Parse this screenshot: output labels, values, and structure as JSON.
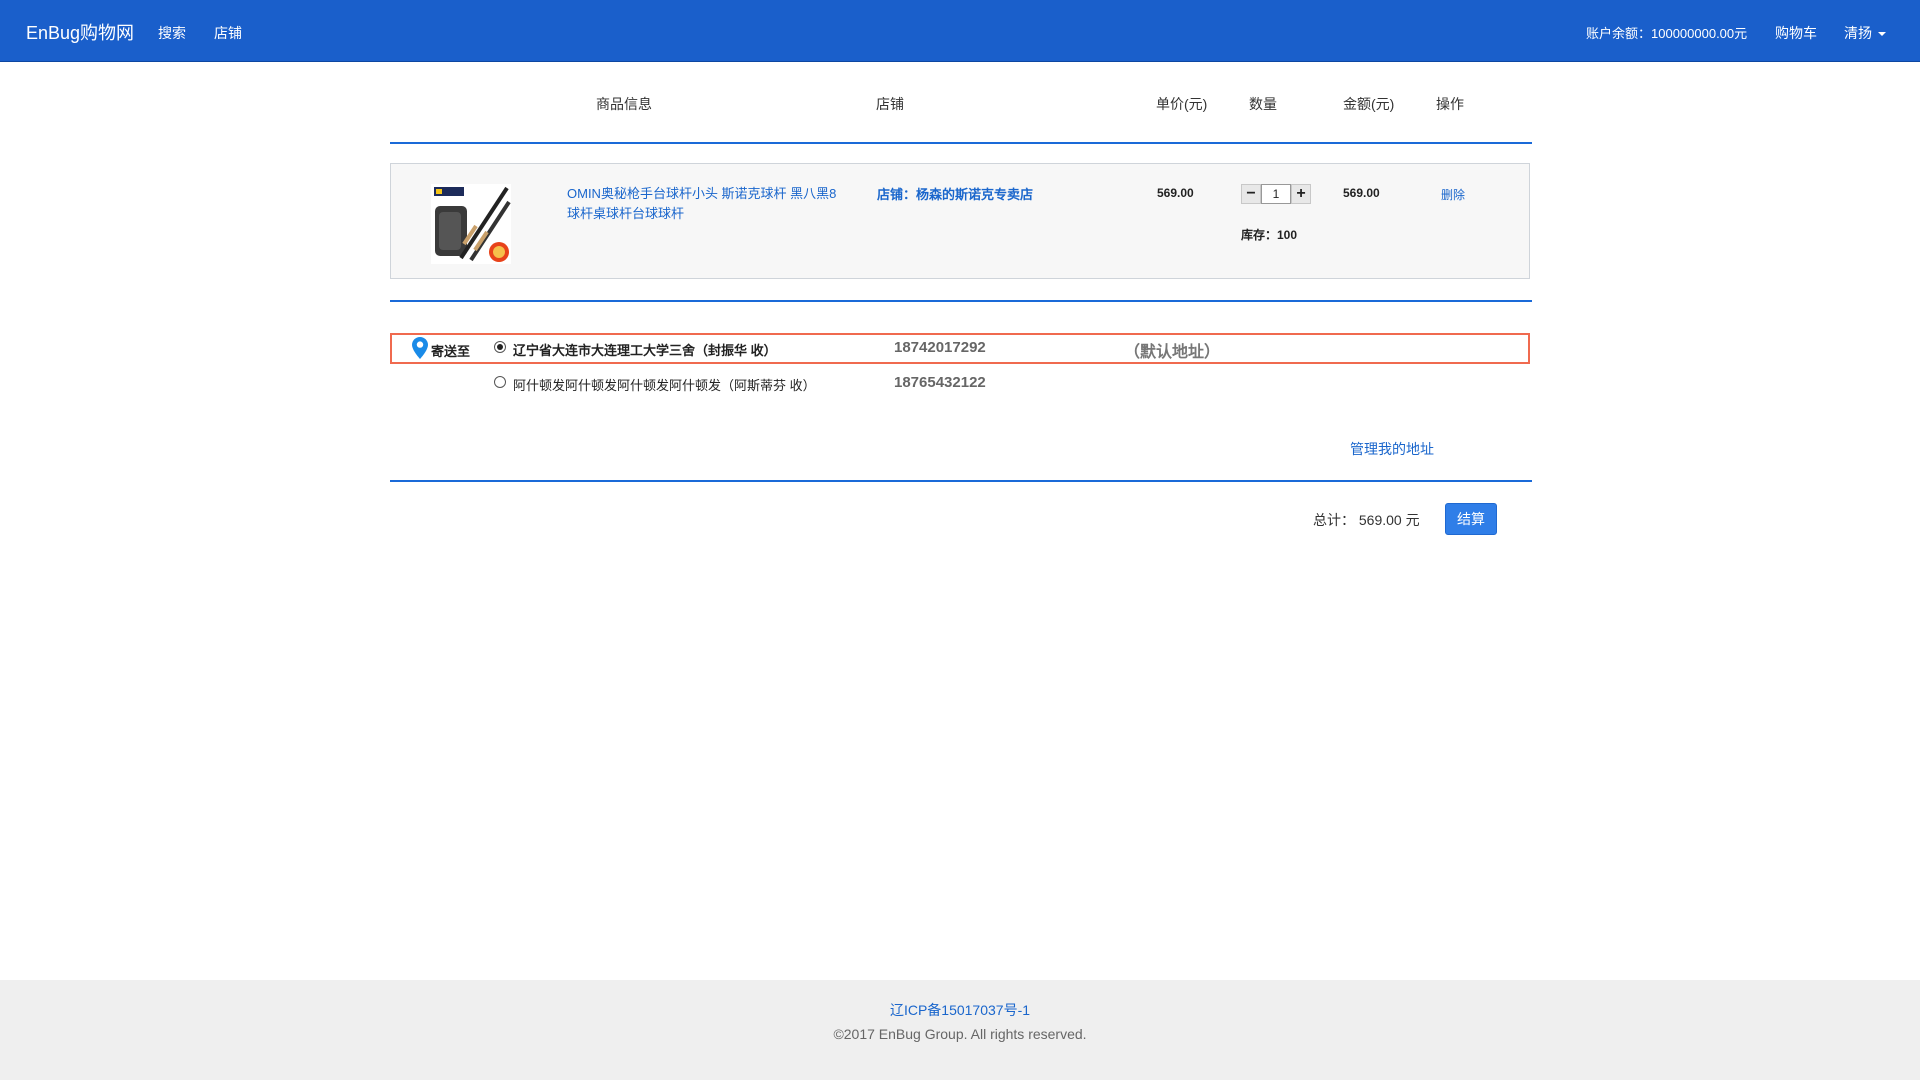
{
  "navbar": {
    "brand": "EnBug购物网",
    "search": "搜索",
    "shops": "店铺",
    "balance": "账户余额：100000000.00元",
    "cart": "购物车",
    "user": "清扬"
  },
  "table_header": {
    "product_info": "商品信息",
    "shop": "店铺",
    "unit_price": "单价(元)",
    "quantity": "数量",
    "amount": "金额(元)",
    "action": "操作"
  },
  "cart_items": [
    {
      "name": "OMIN奥秘枪手台球杆小头 斯诺克球杆 黑八黑8球杆桌球杆台球球杆",
      "shop": "店铺：杨森的斯诺克专卖店",
      "price": "569.00",
      "quantity": "1",
      "stock": "库存：100",
      "amount": "569.00",
      "delete": "删除"
    }
  ],
  "shipping": {
    "label": "寄送至",
    "addresses": [
      {
        "text": "辽宁省大连市大连理工大学三舍（封振华 收）",
        "phone": "18742017292",
        "default_tag": "（默认地址）",
        "selected": true
      },
      {
        "text": "阿什顿发阿什顿发阿什顿发阿什顿发（阿斯蒂芬 收）",
        "phone": "18765432122",
        "selected": false
      }
    ],
    "manage": "管理我的地址"
  },
  "summary": {
    "total": "总计： 569.00 元",
    "checkout": "结算"
  },
  "footer": {
    "icp": "辽ICP备15017037号-1",
    "copyright": "©2017 EnBug Group. All rights reserved."
  },
  "colors": {
    "navbar": "#1a5fcb",
    "link": "#1a66cc",
    "divider": "#1a6ad8",
    "address_highlight": "#f06a4f",
    "button": "#2f7ee8"
  }
}
